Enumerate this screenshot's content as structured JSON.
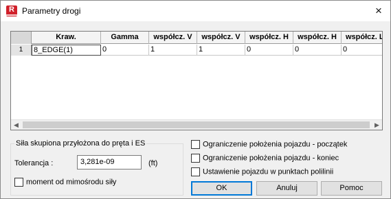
{
  "window": {
    "title": "Parametry drogi",
    "app_icon": "R",
    "close_icon": "×"
  },
  "grid": {
    "columns": [
      "Kraw.",
      "Gamma",
      "współcz. V",
      "współcz. V",
      "współcz. H",
      "współcz. H",
      "współcz. L"
    ],
    "rows": [
      {
        "num": "1",
        "cells": [
          "8_EDGE(1)",
          "0",
          "1",
          "1",
          "0",
          "0",
          "0"
        ]
      }
    ],
    "scroll_left": "◀",
    "scroll_right": "▶"
  },
  "force_group": {
    "title": "Siła skupiona przyłożona do pręta i ES",
    "tolerance_label": "Tolerancja :",
    "tolerance_value": "3,281e-09",
    "tolerance_unit": "(ft)",
    "eccentricity_label": "moment od mimośrodu siły",
    "eccentricity_checked": false
  },
  "options": {
    "start_limit_label": "Ograniczenie położenia pojazdu - początek",
    "start_limit_checked": false,
    "end_limit_label": "Ograniczenie położenia pojazdu - koniec",
    "end_limit_checked": false,
    "polyline_points_label": "Ustawienie pojazdu w punktach polilinii",
    "polyline_points_checked": false
  },
  "buttons": {
    "ok": "OK",
    "cancel": "Anuluj",
    "help": "Pomoc"
  },
  "colors": {
    "app_icon_bg": "#d0202a",
    "focus_border": "#0078d7",
    "dialog_bg": "#f0f0f0"
  }
}
